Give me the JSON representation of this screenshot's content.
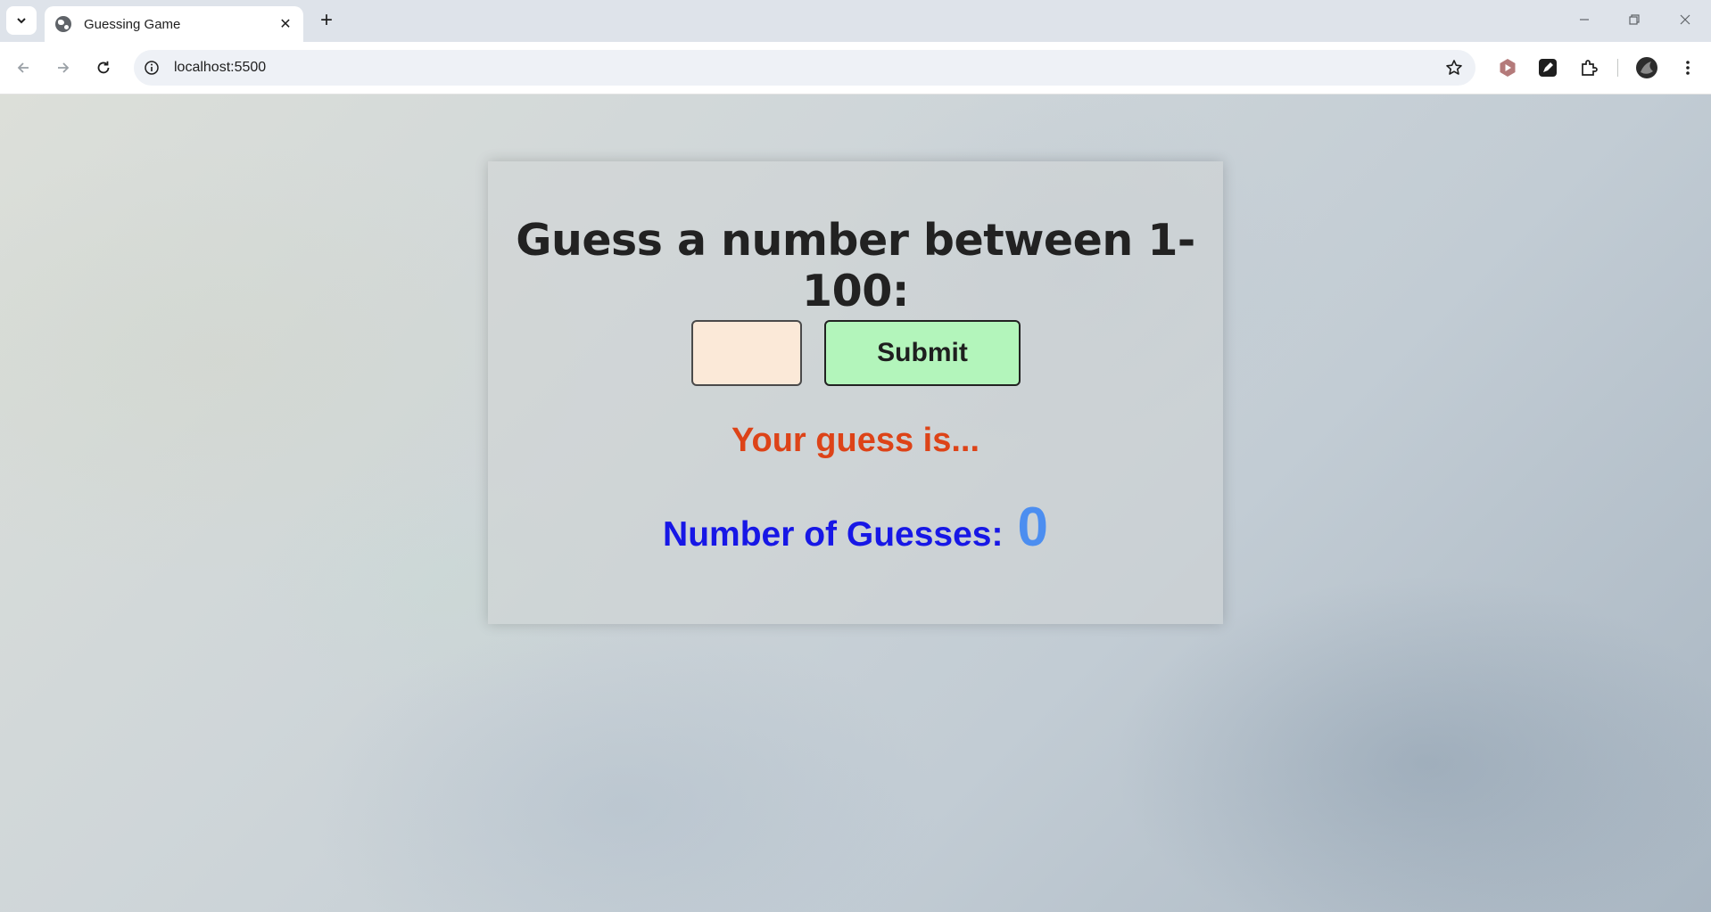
{
  "browser": {
    "tab": {
      "title": "Guessing Game"
    },
    "address_bar": {
      "url": "localhost:5500"
    }
  },
  "game": {
    "heading": "Guess a number between 1-100:",
    "input": {
      "value": "",
      "placeholder": ""
    },
    "submit_label": "Submit",
    "result_text": "Your guess is...",
    "guess_count_label": "Number of Guesses:",
    "guess_count": "0"
  },
  "colors": {
    "input_bg": "#fbe9d8",
    "submit_bg": "#b3f5bb",
    "result_text": "#dd4318",
    "count_label": "#1717e6",
    "count_value": "#4c8ef0"
  }
}
